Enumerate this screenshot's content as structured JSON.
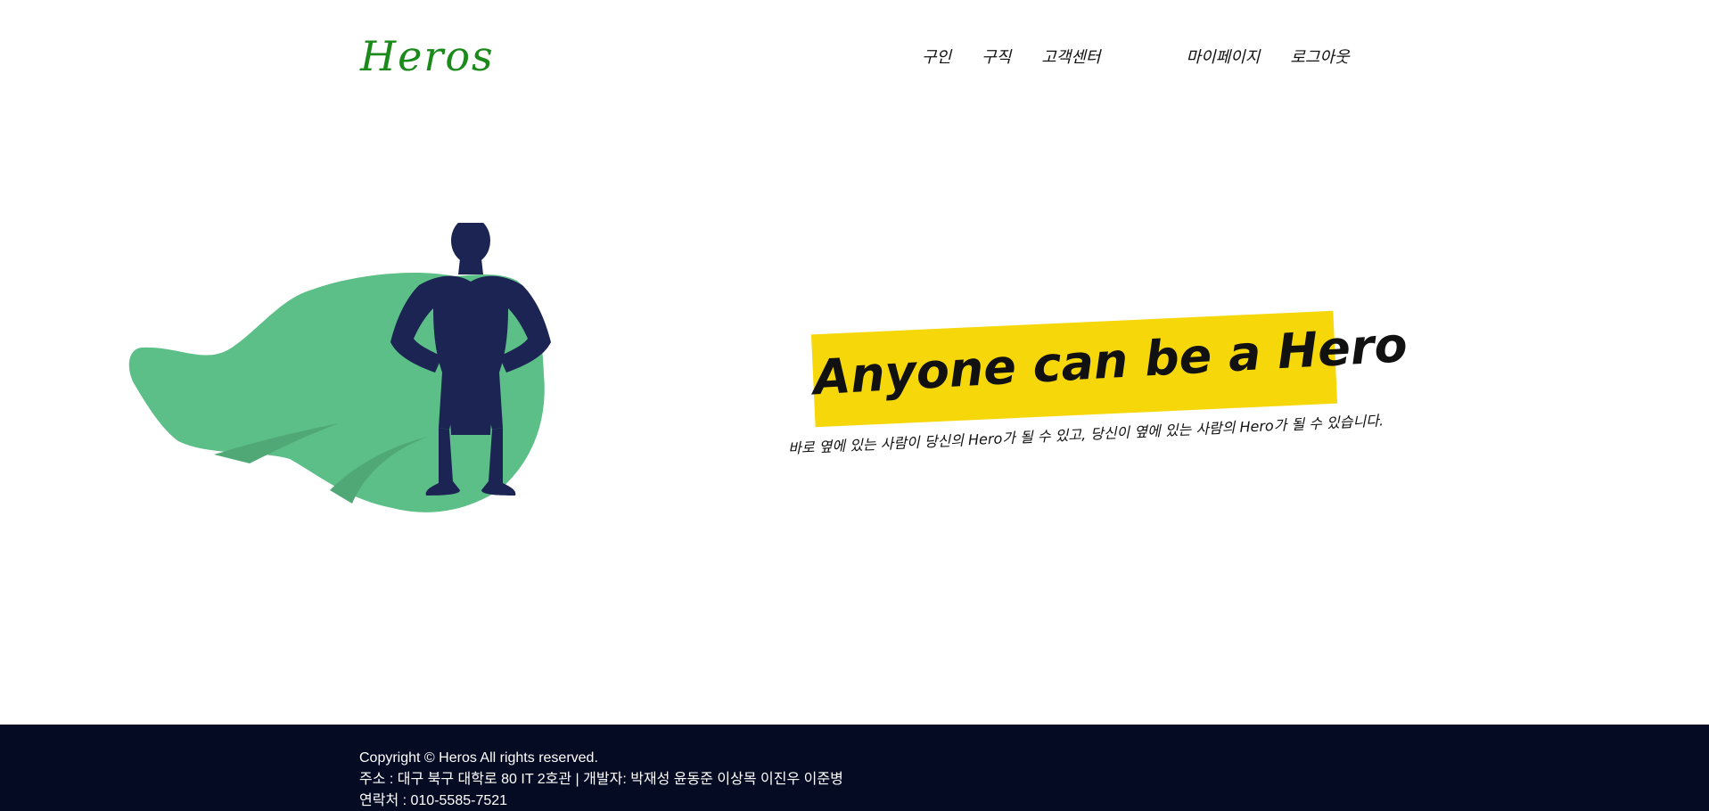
{
  "header": {
    "logo": "Heros",
    "nav": [
      {
        "label": "구인"
      },
      {
        "label": "구직"
      },
      {
        "label": "고객센터"
      },
      {
        "label": "마이페이지"
      },
      {
        "label": "로그아웃"
      }
    ]
  },
  "hero": {
    "title": "Anyone can be a Hero",
    "subtitle": "바로 옆에 있는 사람이 당신의 Hero가 될 수 있고,  당신이 옆에 있는 사람의 Hero가 될 수 있습니다.",
    "banner_color": "#f5d70a",
    "cape_color": "#5cbf87",
    "figure_color": "#1b2452"
  },
  "footer": {
    "copyright": "Copyright © Heros All rights reserved.",
    "address_line": "주소 : 대구 북구 대학로 80 IT 2호관 | 개발자: 박재성 윤동준 이상목 이진우 이준병",
    "contact_line": "연락처 : 010-5585-7521",
    "background": "#060b24"
  }
}
